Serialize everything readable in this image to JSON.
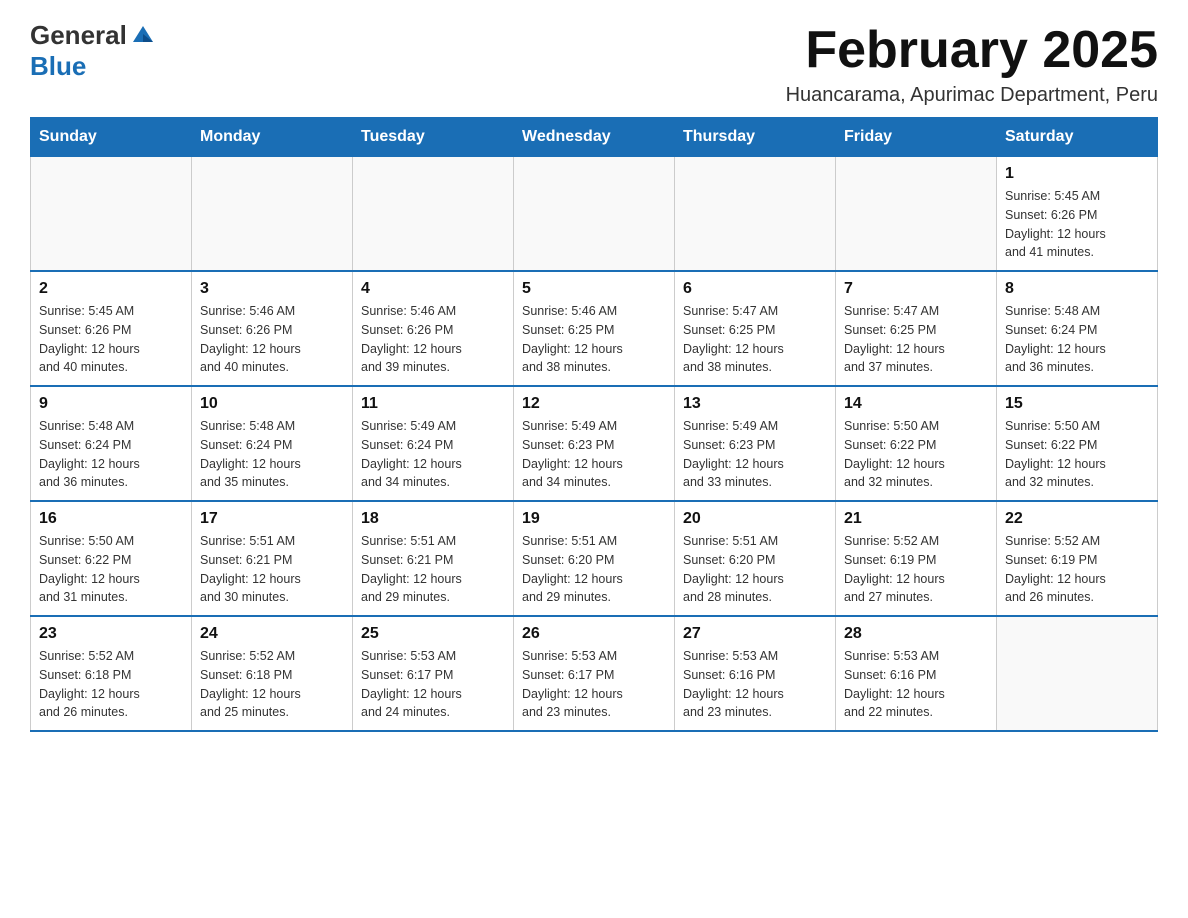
{
  "logo": {
    "text_general": "General",
    "text_blue": "Blue",
    "triangle_color": "#1a6eb5"
  },
  "header": {
    "month_title": "February 2025",
    "location": "Huancarama, Apurimac Department, Peru"
  },
  "weekdays": [
    "Sunday",
    "Monday",
    "Tuesday",
    "Wednesday",
    "Thursday",
    "Friday",
    "Saturday"
  ],
  "weeks": [
    {
      "days": [
        {
          "number": "",
          "info": ""
        },
        {
          "number": "",
          "info": ""
        },
        {
          "number": "",
          "info": ""
        },
        {
          "number": "",
          "info": ""
        },
        {
          "number": "",
          "info": ""
        },
        {
          "number": "",
          "info": ""
        },
        {
          "number": "1",
          "info": "Sunrise: 5:45 AM\nSunset: 6:26 PM\nDaylight: 12 hours\nand 41 minutes."
        }
      ]
    },
    {
      "days": [
        {
          "number": "2",
          "info": "Sunrise: 5:45 AM\nSunset: 6:26 PM\nDaylight: 12 hours\nand 40 minutes."
        },
        {
          "number": "3",
          "info": "Sunrise: 5:46 AM\nSunset: 6:26 PM\nDaylight: 12 hours\nand 40 minutes."
        },
        {
          "number": "4",
          "info": "Sunrise: 5:46 AM\nSunset: 6:26 PM\nDaylight: 12 hours\nand 39 minutes."
        },
        {
          "number": "5",
          "info": "Sunrise: 5:46 AM\nSunset: 6:25 PM\nDaylight: 12 hours\nand 38 minutes."
        },
        {
          "number": "6",
          "info": "Sunrise: 5:47 AM\nSunset: 6:25 PM\nDaylight: 12 hours\nand 38 minutes."
        },
        {
          "number": "7",
          "info": "Sunrise: 5:47 AM\nSunset: 6:25 PM\nDaylight: 12 hours\nand 37 minutes."
        },
        {
          "number": "8",
          "info": "Sunrise: 5:48 AM\nSunset: 6:24 PM\nDaylight: 12 hours\nand 36 minutes."
        }
      ]
    },
    {
      "days": [
        {
          "number": "9",
          "info": "Sunrise: 5:48 AM\nSunset: 6:24 PM\nDaylight: 12 hours\nand 36 minutes."
        },
        {
          "number": "10",
          "info": "Sunrise: 5:48 AM\nSunset: 6:24 PM\nDaylight: 12 hours\nand 35 minutes."
        },
        {
          "number": "11",
          "info": "Sunrise: 5:49 AM\nSunset: 6:24 PM\nDaylight: 12 hours\nand 34 minutes."
        },
        {
          "number": "12",
          "info": "Sunrise: 5:49 AM\nSunset: 6:23 PM\nDaylight: 12 hours\nand 34 minutes."
        },
        {
          "number": "13",
          "info": "Sunrise: 5:49 AM\nSunset: 6:23 PM\nDaylight: 12 hours\nand 33 minutes."
        },
        {
          "number": "14",
          "info": "Sunrise: 5:50 AM\nSunset: 6:22 PM\nDaylight: 12 hours\nand 32 minutes."
        },
        {
          "number": "15",
          "info": "Sunrise: 5:50 AM\nSunset: 6:22 PM\nDaylight: 12 hours\nand 32 minutes."
        }
      ]
    },
    {
      "days": [
        {
          "number": "16",
          "info": "Sunrise: 5:50 AM\nSunset: 6:22 PM\nDaylight: 12 hours\nand 31 minutes."
        },
        {
          "number": "17",
          "info": "Sunrise: 5:51 AM\nSunset: 6:21 PM\nDaylight: 12 hours\nand 30 minutes."
        },
        {
          "number": "18",
          "info": "Sunrise: 5:51 AM\nSunset: 6:21 PM\nDaylight: 12 hours\nand 29 minutes."
        },
        {
          "number": "19",
          "info": "Sunrise: 5:51 AM\nSunset: 6:20 PM\nDaylight: 12 hours\nand 29 minutes."
        },
        {
          "number": "20",
          "info": "Sunrise: 5:51 AM\nSunset: 6:20 PM\nDaylight: 12 hours\nand 28 minutes."
        },
        {
          "number": "21",
          "info": "Sunrise: 5:52 AM\nSunset: 6:19 PM\nDaylight: 12 hours\nand 27 minutes."
        },
        {
          "number": "22",
          "info": "Sunrise: 5:52 AM\nSunset: 6:19 PM\nDaylight: 12 hours\nand 26 minutes."
        }
      ]
    },
    {
      "days": [
        {
          "number": "23",
          "info": "Sunrise: 5:52 AM\nSunset: 6:18 PM\nDaylight: 12 hours\nand 26 minutes."
        },
        {
          "number": "24",
          "info": "Sunrise: 5:52 AM\nSunset: 6:18 PM\nDaylight: 12 hours\nand 25 minutes."
        },
        {
          "number": "25",
          "info": "Sunrise: 5:53 AM\nSunset: 6:17 PM\nDaylight: 12 hours\nand 24 minutes."
        },
        {
          "number": "26",
          "info": "Sunrise: 5:53 AM\nSunset: 6:17 PM\nDaylight: 12 hours\nand 23 minutes."
        },
        {
          "number": "27",
          "info": "Sunrise: 5:53 AM\nSunset: 6:16 PM\nDaylight: 12 hours\nand 23 minutes."
        },
        {
          "number": "28",
          "info": "Sunrise: 5:53 AM\nSunset: 6:16 PM\nDaylight: 12 hours\nand 22 minutes."
        },
        {
          "number": "",
          "info": ""
        }
      ]
    }
  ]
}
